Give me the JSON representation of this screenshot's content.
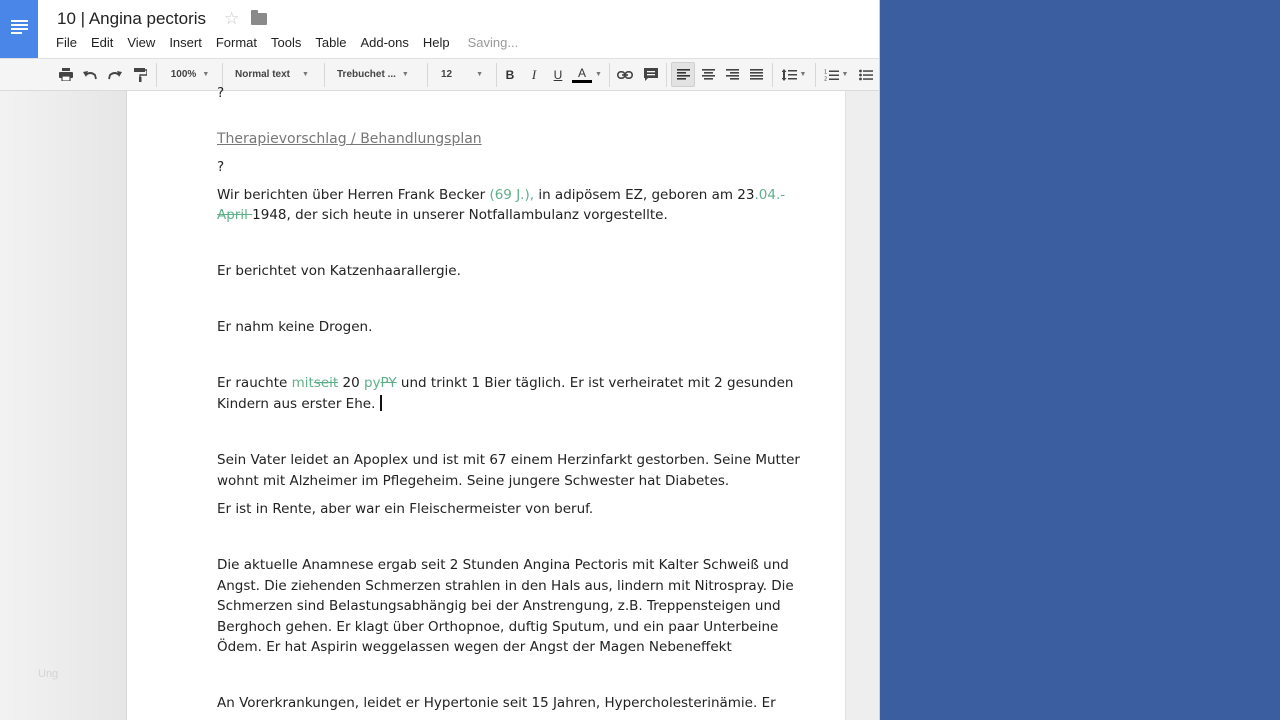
{
  "document": {
    "title": "10 | Angina pectoris",
    "star_glyph": "☆"
  },
  "menu": {
    "items": [
      "File",
      "Edit",
      "View",
      "Insert",
      "Format",
      "Tools",
      "Table",
      "Add-ons",
      "Help"
    ],
    "status": "Saving..."
  },
  "toolbar": {
    "zoom": "100%",
    "style": "Normal text",
    "font": "Trebuchet ...",
    "font_size": "12",
    "bold": "B",
    "italic": "I",
    "underline": "U",
    "text_color": "A",
    "text_color_value": "#000000",
    "icons": [
      "print-icon",
      "undo-icon",
      "redo-icon",
      "paint-format-icon",
      "link-icon",
      "comment-icon",
      "align-left-icon",
      "align-center-icon",
      "align-right-icon",
      "align-justify-icon",
      "line-spacing-icon",
      "numbered-list-icon",
      "bulleted-list-icon"
    ]
  },
  "sidebar": {
    "ghost_label": "Ung"
  },
  "body": {
    "top_fragment": "?",
    "heading": "Therapievorschlag / Behandlungsplan",
    "q_mark": "?",
    "p1": {
      "a": "Wir berichten über Herren Frank Becker ",
      "b": "(69 J.),",
      "c": " in adipösem EZ, geboren am 23",
      "d": ".04.-",
      "e": "April ",
      "f": "1948, der sich heute in unserer Notfallambulanz vorgestellte."
    },
    "p2": "Er berichtet von Katzenhaarallergie.",
    "p3": "Er nahm keine Drogen.",
    "p4": {
      "a": "Er rauchte ",
      "b": "mit",
      "c": "seit",
      "d": " 20 ",
      "e": "py",
      "f": "PY",
      "g": " und trinkt 1 Bier täglich. Er ist verheiratet mit 2 gesunden",
      "h": "Kindern aus erster Ehe."
    },
    "p5": [
      "Sein Vater leidet an Apoplex und ist mit 67 einem Herzinfarkt gestorben. Seine Mutter",
      "wohnt mit Alzheimer im Pflegeheim. Seine jungere Schwester hat Diabetes."
    ],
    "p6": "Er ist in Rente, aber war ein Fleischermeister von beruf.",
    "p7": [
      "Die aktuelle Anamnese ergab seit 2 Stunden Angina Pectoris mit Kalter Schweiß und",
      "Angst. Die ziehenden Schmerzen strahlen in den Hals aus, lindern mit Nitrospray. Die",
      "Schmerzen sind Belastungsabhängig bei der Anstrengung, z.B. Treppensteigen und",
      "Berghoch gehen. Er klagt über Orthopnoe, duftig Sputum, und ein paar Unterbeine",
      "Ödem. Er hat Aspirin weggelassen wegen der Angst der Magen Nebeneffekt"
    ],
    "p8": "An Vorerkrankungen, leidet er Hypertonie seit 15 Jahren, Hypercholesterinämie. Er"
  },
  "colors": {
    "logo": "#4a86e8",
    "suggestion": "#5fb08a",
    "right_panel": "#3b5ea0"
  }
}
